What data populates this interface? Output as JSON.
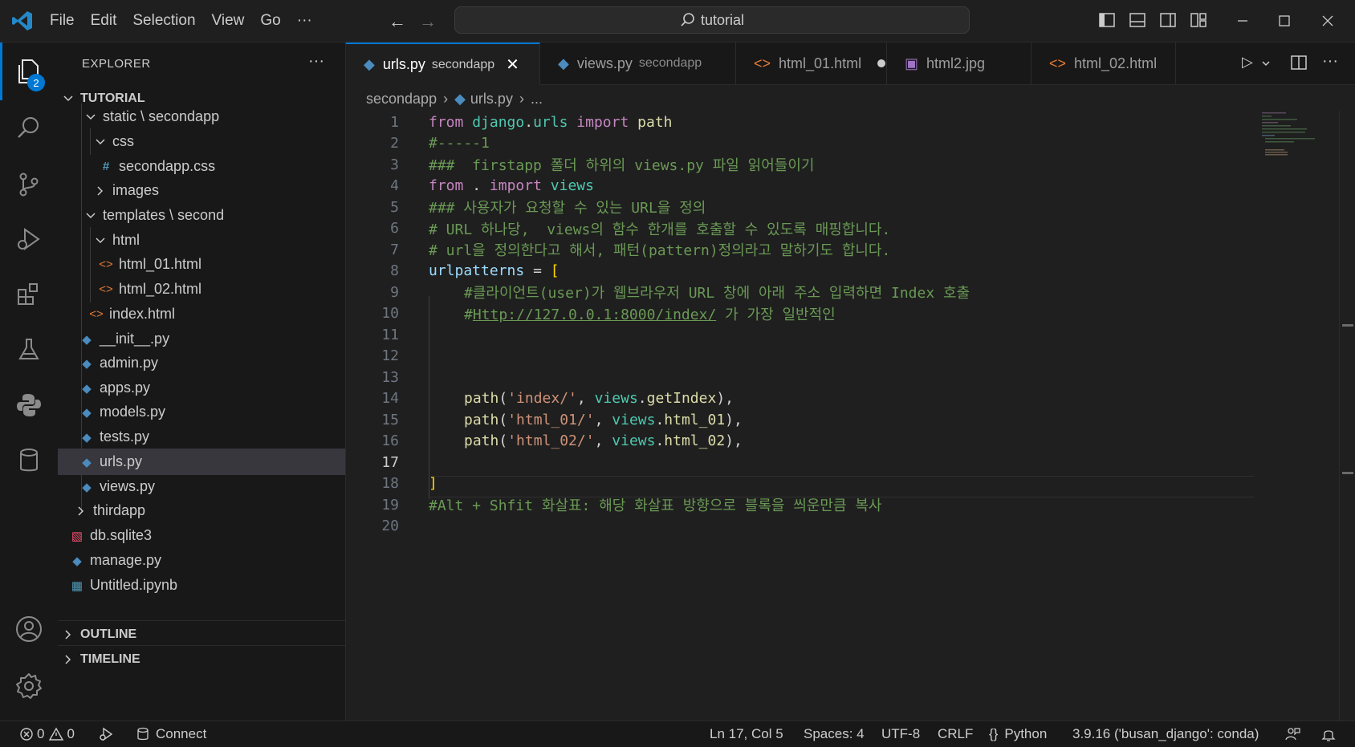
{
  "titlebar": {
    "menu": [
      "File",
      "Edit",
      "Selection",
      "View",
      "Go",
      "···"
    ],
    "search_text": "tutorial"
  },
  "activity_bar": {
    "items": [
      "explorer-icon",
      "search-icon",
      "source-control-icon",
      "run-debug-icon",
      "extensions-icon",
      "testing-icon",
      "python-icon",
      "database-icon"
    ],
    "explorer_badge": "2",
    "bottom": [
      "account-icon",
      "settings-gear-icon"
    ]
  },
  "sidebar": {
    "title": "EXPLORER",
    "more": "···",
    "root": "TUTORIAL",
    "tree": [
      {
        "label": "static \\ secondapp",
        "type": "folder-open"
      },
      {
        "label": "css",
        "type": "folder-open"
      },
      {
        "label": "secondapp.css",
        "type": "css"
      },
      {
        "label": "images",
        "type": "folder-closed"
      },
      {
        "label": "templates \\ second",
        "type": "folder-open"
      },
      {
        "label": "html",
        "type": "folder-open"
      },
      {
        "label": "html_01.html",
        "type": "html"
      },
      {
        "label": "html_02.html",
        "type": "html"
      },
      {
        "label": "index.html",
        "type": "html"
      },
      {
        "label": "__init__.py",
        "type": "python"
      },
      {
        "label": "admin.py",
        "type": "python"
      },
      {
        "label": "apps.py",
        "type": "python"
      },
      {
        "label": "models.py",
        "type": "python"
      },
      {
        "label": "tests.py",
        "type": "python"
      },
      {
        "label": "urls.py",
        "type": "python"
      },
      {
        "label": "views.py",
        "type": "python"
      },
      {
        "label": "thirdapp",
        "type": "folder-closed"
      },
      {
        "label": "db.sqlite3",
        "type": "db"
      },
      {
        "label": "manage.py",
        "type": "python"
      },
      {
        "label": "Untitled.ipynb",
        "type": "notebook"
      }
    ],
    "sections": [
      "OUTLINE",
      "TIMELINE"
    ]
  },
  "tabs": [
    {
      "label": "urls.py",
      "desc": "secondapp",
      "active": true
    },
    {
      "label": "views.py",
      "desc": "secondapp"
    },
    {
      "label": "html_01.html",
      "modified": true
    },
    {
      "label": "html2.jpg"
    },
    {
      "label": "html_02.html"
    }
  ],
  "breadcrumb": [
    "secondapp",
    "urls.py",
    "..."
  ],
  "editor": {
    "line_numbers": [
      "1",
      "2",
      "3",
      "4",
      "5",
      "6",
      "7",
      "8",
      "9",
      "10",
      "11",
      "12",
      "13",
      "14",
      "15",
      "16",
      "17",
      "18",
      "19",
      "20"
    ],
    "current_line": "17",
    "lines": {
      "l1": [
        "from",
        "django",
        ".",
        "urls",
        "import",
        "path"
      ],
      "l2": "#-----1",
      "l3": "###  firstapp 폴더 하위의 views.py 파일 읽어들이기",
      "l4": [
        "from",
        ".",
        "import",
        "views"
      ],
      "l5": "### 사용자가 요청할 수 있는 URL을 정의",
      "l6": "# URL 하나당,  views의 함수 한개를 호출할 수 있도록 매핑합니다.",
      "l7": "# url을 정의한다고 해서, 패턴(pattern)정의라고 말하기도 합니다.",
      "l8": [
        "urlpatterns",
        "=",
        "["
      ],
      "l9": "#클라이언트(user)가 웹브라우저 URL 창에 아래 주소 입력하면 Index 호출",
      "l10": [
        "#",
        "Http://127.0.0.1:8000/index/",
        " 가 가장 일반적인"
      ],
      "l14": [
        "path",
        "(",
        "'index/'",
        ", ",
        "views",
        ".",
        "getIndex",
        "),"
      ],
      "l15": [
        "path",
        "(",
        "'html_01/'",
        ", ",
        "views",
        ".",
        "html_01",
        "),"
      ],
      "l16": [
        "path",
        "(",
        "'html_02/'",
        ", ",
        "views",
        ".",
        "html_02",
        "),"
      ],
      "l18": "]",
      "l19": "#Alt + Shfit 화살표: 해당 화살표 방향으로 블록을 씌운만큼 복사"
    }
  },
  "statusbar": {
    "errors": "0",
    "warnings": "0",
    "connect": "Connect",
    "position": "Ln 17, Col 5",
    "spaces": "Spaces: 4",
    "encoding": "UTF-8",
    "eol": "CRLF",
    "language": "Python",
    "interpreter": "3.9.16 ('busan_django': conda)"
  },
  "colors": {
    "accent": "#0078d4",
    "keyword": "#c586c0",
    "comment": "#6a9955",
    "string": "#ce9178"
  }
}
